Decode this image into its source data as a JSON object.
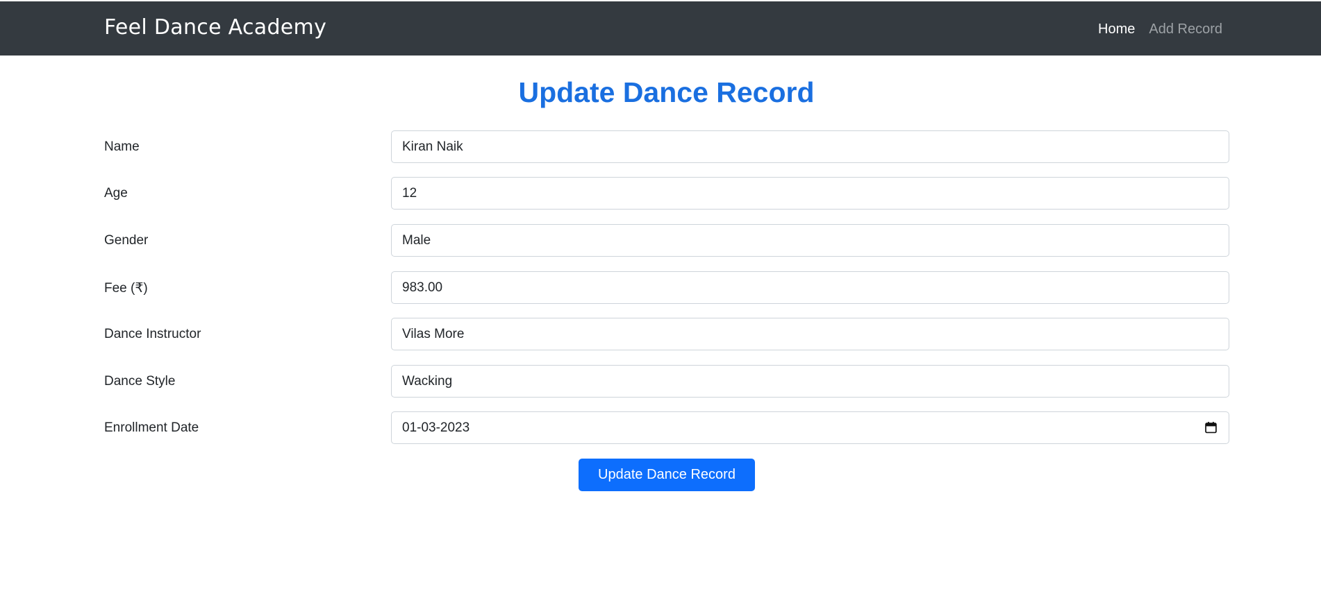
{
  "navbar": {
    "brand": "Feel Dance Academy",
    "links": [
      {
        "label": "Home",
        "active": true
      },
      {
        "label": "Add Record",
        "active": false
      }
    ]
  },
  "page": {
    "title": "Update Dance Record"
  },
  "form": {
    "fields": [
      {
        "label": "Name",
        "value": "Kiran Naik"
      },
      {
        "label": "Age",
        "value": "12"
      },
      {
        "label": "Gender",
        "value": "Male"
      },
      {
        "label": "Fee (₹)",
        "value": "983.00"
      },
      {
        "label": "Dance Instructor",
        "value": "Vilas More"
      },
      {
        "label": "Dance Style",
        "value": "Wacking"
      },
      {
        "label": "Enrollment Date",
        "value": "01-03-2023",
        "icon": "calendar-icon"
      }
    ],
    "submit_label": "Update Dance Record"
  },
  "colors": {
    "navbar_bg": "#343a40",
    "title_color": "#1a6fe0",
    "button_bg": "#0d6efd"
  }
}
